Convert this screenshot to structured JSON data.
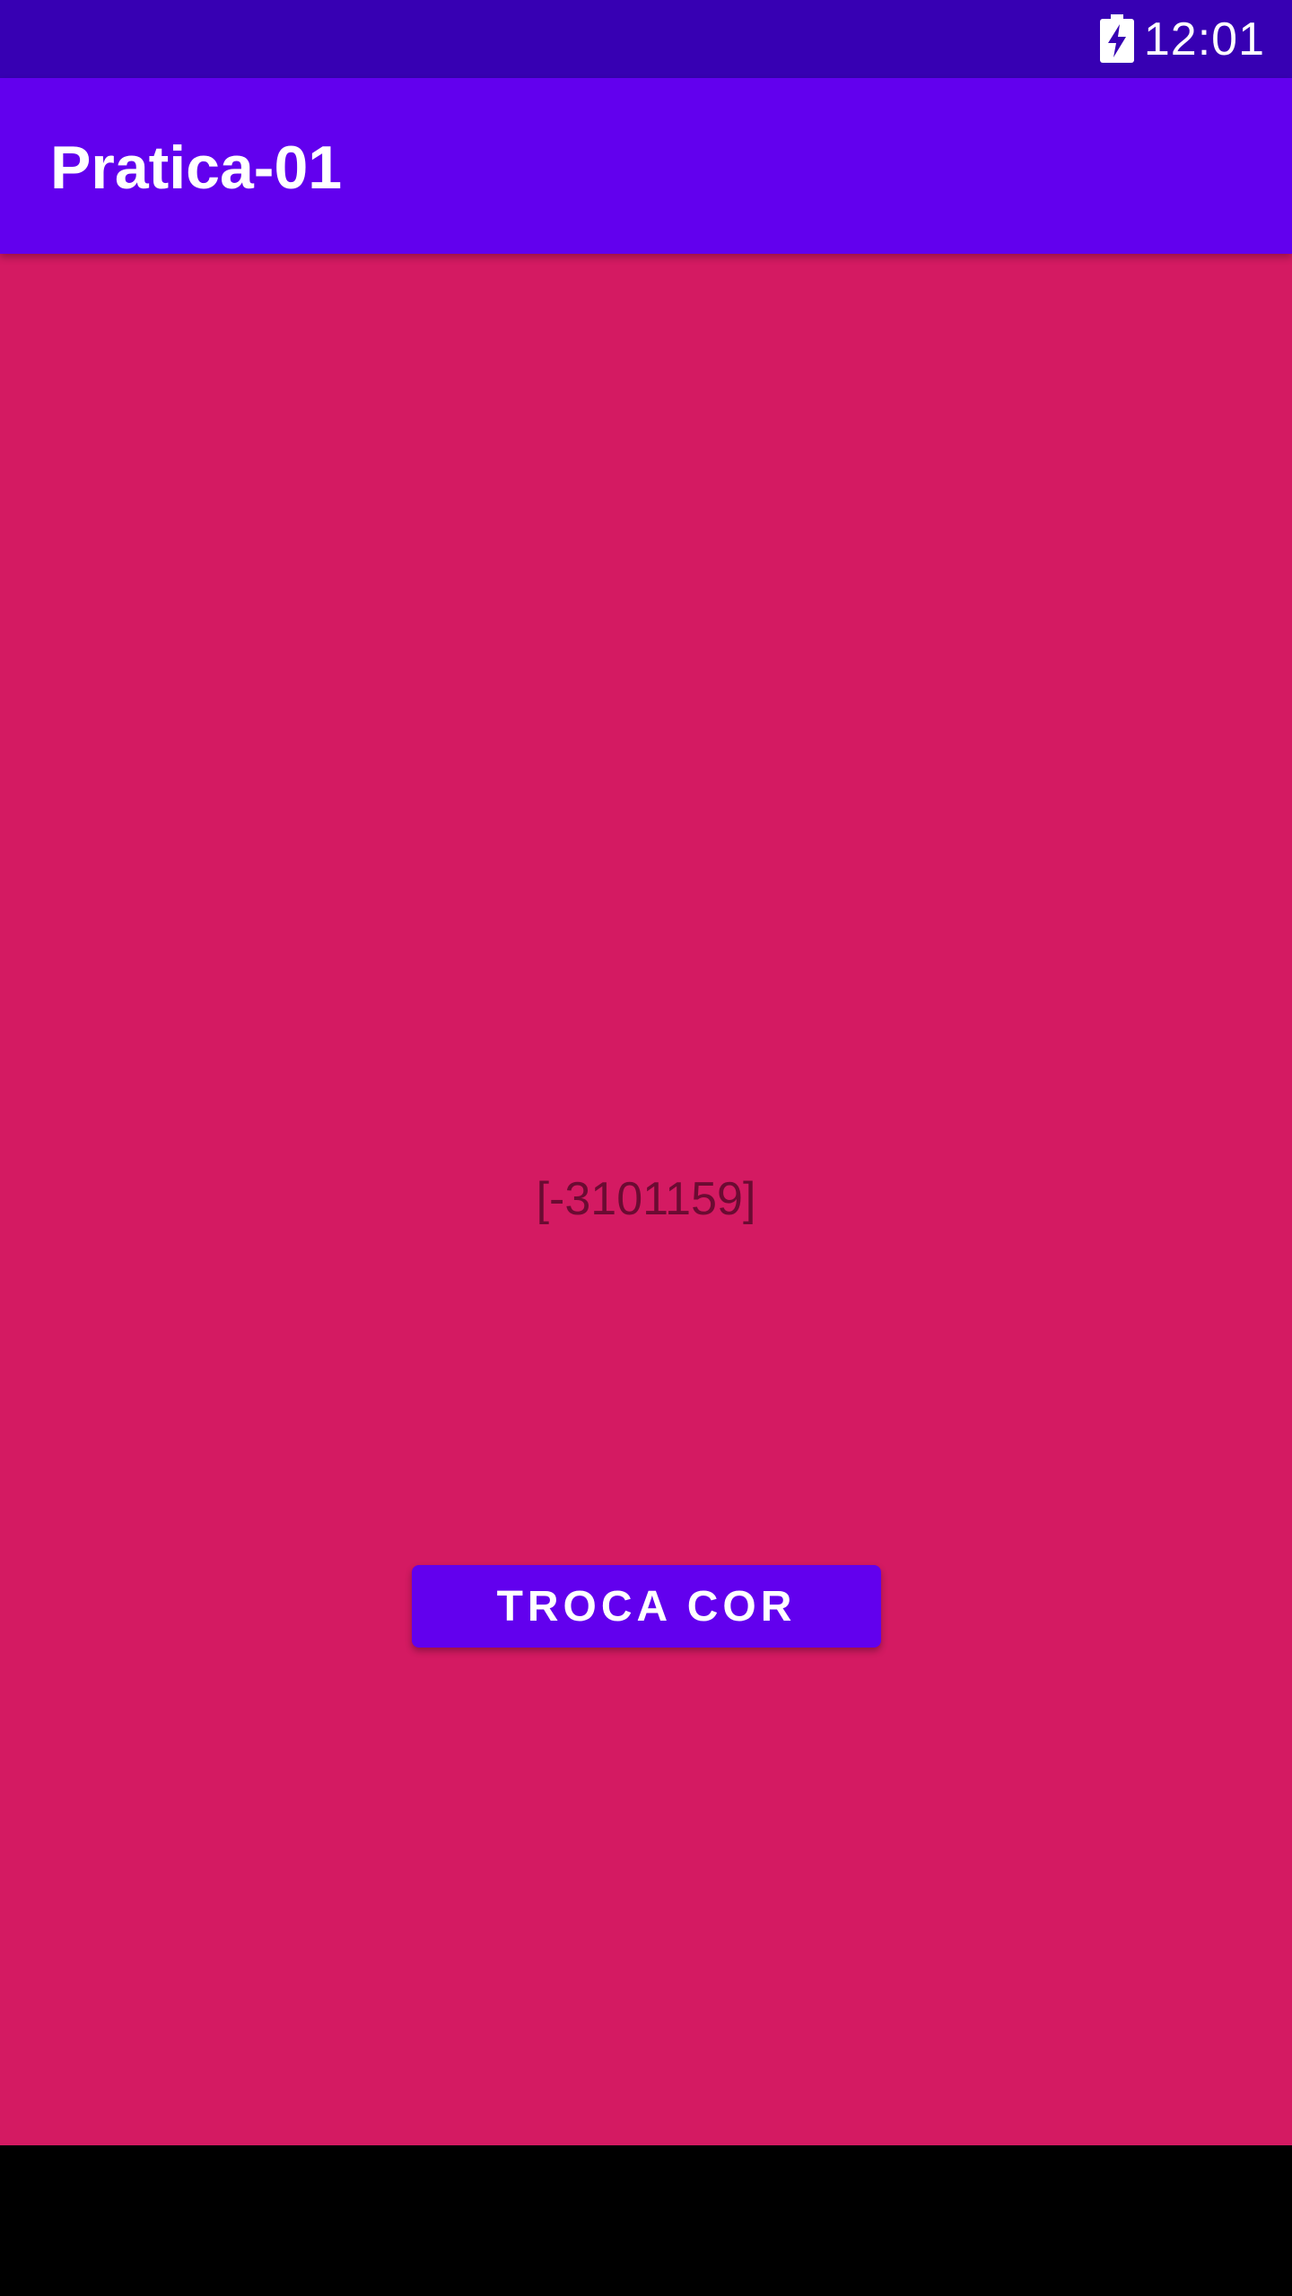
{
  "status_bar": {
    "time": "12:01",
    "battery_icon": "battery-charging-icon"
  },
  "app_bar": {
    "title": "Pratica-01"
  },
  "main": {
    "color_value": "[-3101159]",
    "button_label": "TROCA COR"
  },
  "colors": {
    "status_bar": "#3700B3",
    "primary": "#6200EE",
    "background": "#D41A62",
    "nav_bar": "#000000"
  }
}
